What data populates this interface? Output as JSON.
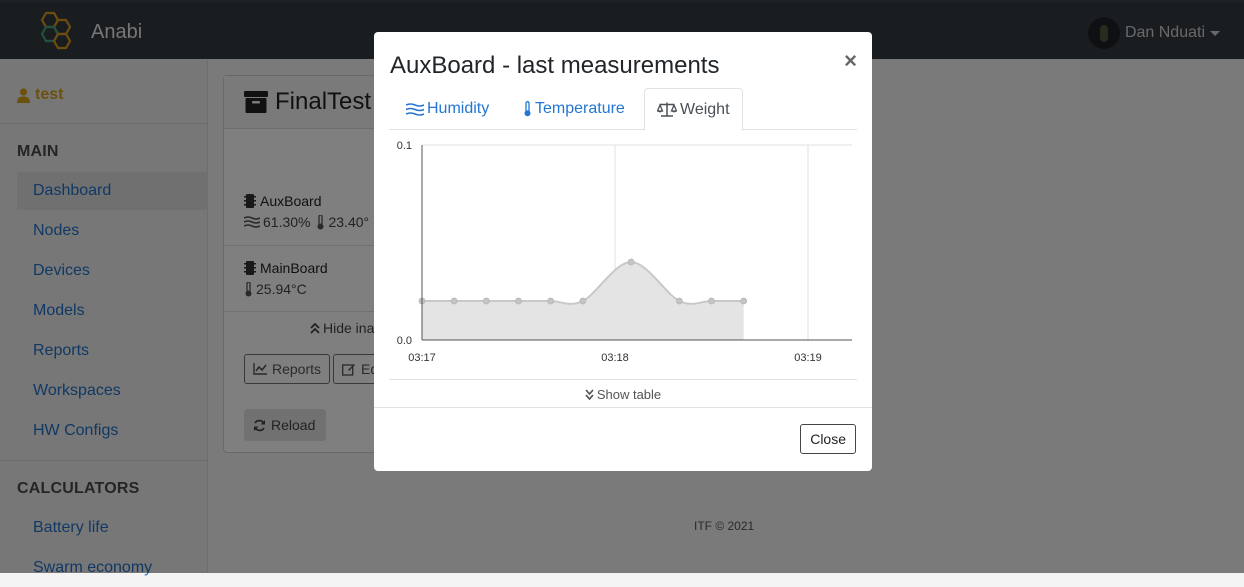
{
  "navbar": {
    "brand": "Anabi",
    "user_name": "Dan Nduati"
  },
  "sidebar": {
    "user": "test",
    "main_heading": "MAIN",
    "main_items": [
      {
        "label": "Dashboard",
        "active": true
      },
      {
        "label": "Nodes"
      },
      {
        "label": "Devices"
      },
      {
        "label": "Models"
      },
      {
        "label": "Reports"
      },
      {
        "label": "Workspaces"
      },
      {
        "label": "HW Configs"
      }
    ],
    "calc_heading": "CALCULATORS",
    "calc_items": [
      {
        "label": "Battery life"
      },
      {
        "label": "Swarm economy"
      }
    ]
  },
  "workspace": {
    "title": "FinalTest",
    "nodes": [
      {
        "name": "AuxBoard",
        "humidity": "61.30%",
        "temperature": "23.40°"
      },
      {
        "name": "MainBoard",
        "temperature": "25.94°C"
      }
    ],
    "hide_inactive": "Hide ina",
    "reports_button": "Reports",
    "edit_button": "Ed",
    "reload_button": "Reload"
  },
  "footer": "ITF © 2021",
  "modal": {
    "title": "AuxBoard - last measurements",
    "close_x": "×",
    "tabs": [
      {
        "label": "Humidity",
        "icon": "water-icon"
      },
      {
        "label": "Temperature",
        "icon": "thermometer-icon"
      },
      {
        "label": "Weight",
        "icon": "balance-scale-icon",
        "active": true
      }
    ],
    "show_table": "Show table",
    "close_button": "Close"
  },
  "chart_data": {
    "type": "area",
    "x": [
      "03:17:00",
      "03:17:10",
      "03:17:20",
      "03:17:30",
      "03:17:40",
      "03:17:50",
      "03:18:05",
      "03:18:20",
      "03:18:30",
      "03:18:40"
    ],
    "y": [
      0.02,
      0.02,
      0.02,
      0.02,
      0.02,
      0.02,
      0.04,
      0.02,
      0.02,
      0.02
    ],
    "xticks": [
      "03:17",
      "03:18",
      "03:19"
    ],
    "yticks": [
      "0.0",
      "0.1"
    ],
    "ylim": [
      0,
      0.1
    ],
    "grid": true,
    "color": "#d8d8d8"
  }
}
